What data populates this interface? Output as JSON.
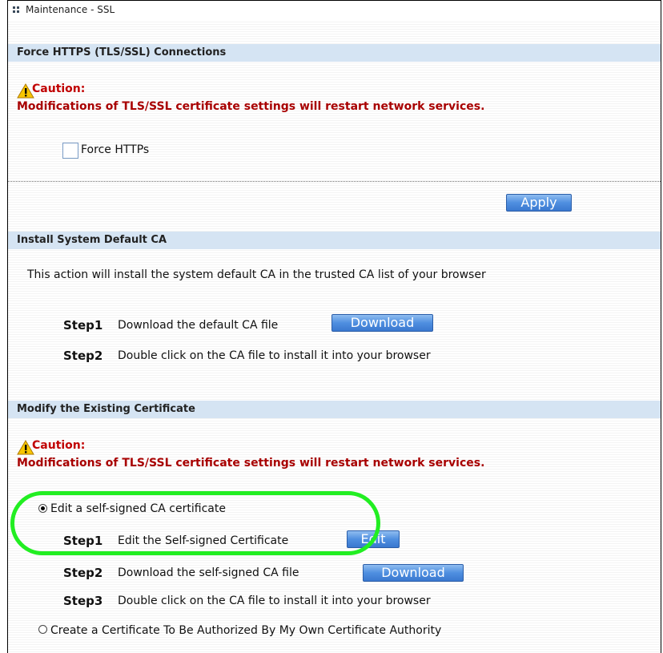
{
  "window": {
    "title": "Maintenance - SSL"
  },
  "force_https_section": {
    "header": "Force HTTPS (TLS/SSL) Connections",
    "caution_title": "Caution:",
    "caution_text": "Modifications of TLS/SSL certificate settings will restart network services.",
    "checkbox_label": "Force HTTPs",
    "checkbox_checked": false,
    "apply_label": "Apply"
  },
  "install_ca_section": {
    "header": "Install System Default CA",
    "description": "This action will install the system default CA in the trusted CA list of your browser",
    "step1_label": "Step1",
    "step1_text": "Download the default CA file",
    "step1_button": "Download",
    "step2_label": "Step2",
    "step2_text": "Double click on the CA file to install it into your browser"
  },
  "modify_cert_section": {
    "header": "Modify the Existing Certificate",
    "caution_title": "Caution:",
    "caution_text": "Modifications of TLS/SSL certificate settings will restart network services.",
    "option1_label": "Edit a self-signed CA certificate",
    "option1_selected": true,
    "step1_label": "Step1",
    "step1_text": "Edit the Self-signed Certificate",
    "step1_button": "Edit",
    "step2_label": "Step2",
    "step2_text": "Download the self-signed CA file",
    "step2_button": "Download",
    "step3_label": "Step3",
    "step3_text": "Double click on the CA file to install it into your browser",
    "option2_label": "Create a Certificate To Be Authorized By My Own Certificate Authority",
    "option2_selected": false
  },
  "colors": {
    "highlight": "#22ee22",
    "caution": "#c00000",
    "section_header": "#d5e4f3",
    "button": "#4f8fe0"
  },
  "icons": {
    "window": "grid-icon",
    "caution": "warning-triangle-icon"
  }
}
